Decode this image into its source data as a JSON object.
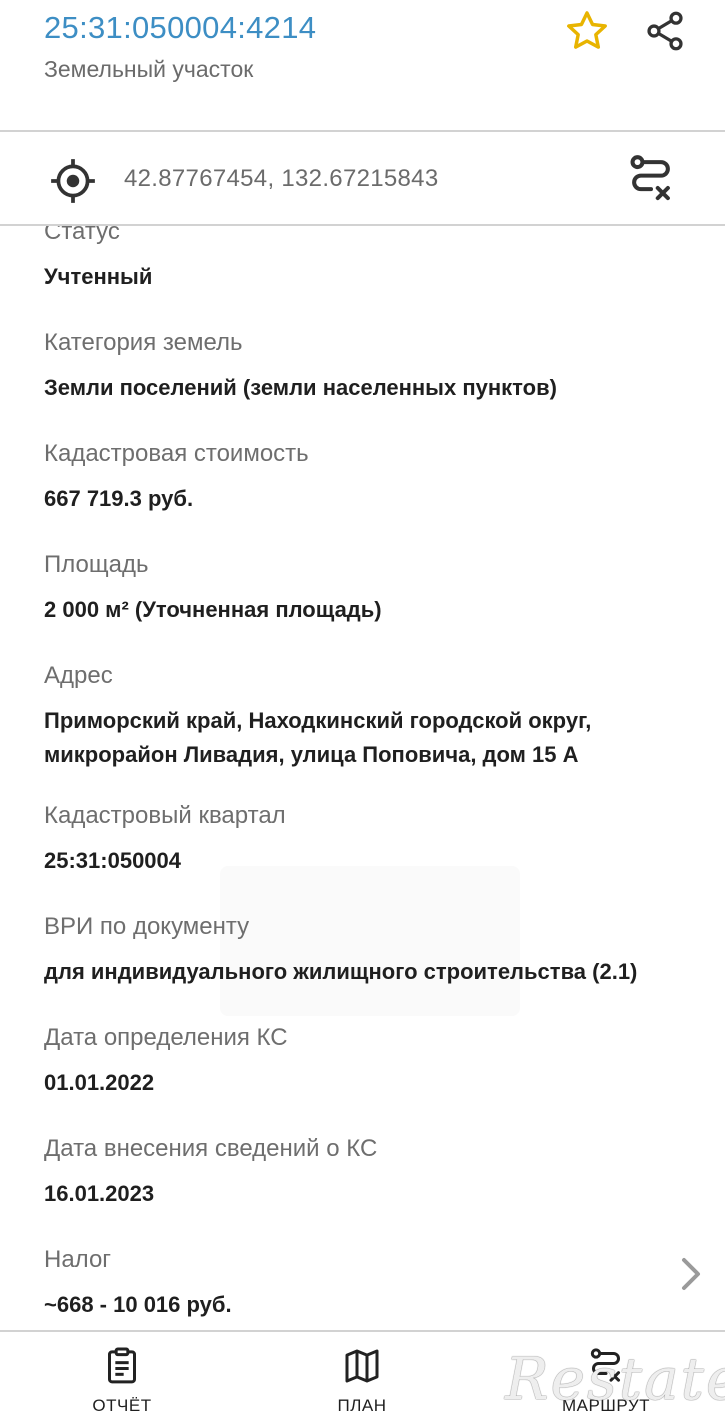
{
  "header": {
    "cadastral_number": "25:31:050004:4214",
    "object_type": "Земельный участок"
  },
  "location": {
    "coordinates": "42.87767454, 132.67215843"
  },
  "fields": [
    {
      "label": "Статус",
      "value": "Учтенный"
    },
    {
      "label": "Категория земель",
      "value": "Земли поселений (земли населенных пунктов)"
    },
    {
      "label": "Кадастровая стоимость",
      "value": "667 719.3 руб."
    },
    {
      "label": "Площадь",
      "value": "2 000 м² (Уточненная площадь)"
    },
    {
      "label": "Адрес",
      "value_line1": "Приморский край, Находкинский городской округ,",
      "value_line2": "микрорайон Ливадия, улица Поповича, дом 15 А"
    },
    {
      "label": "Кадастровый квартал",
      "value": "25:31:050004"
    },
    {
      "label": "ВРИ по документу",
      "value": "для индивидуального жилищного строительства (2.1)"
    },
    {
      "label": "Дата определения КС",
      "value": "01.01.2022"
    },
    {
      "label": "Дата внесения сведений о КС",
      "value": "16.01.2023"
    },
    {
      "label": "Налог",
      "value": "~668 - 10 016 руб."
    }
  ],
  "bottom_nav": {
    "report": "ОТЧЁТ",
    "plan": "ПЛАН",
    "route": "МАРШРУТ"
  },
  "watermark": "Restate",
  "colors": {
    "accent": "#3d8ec4",
    "star": "#e8b400",
    "label": "#6e6e6e",
    "divider": "#d2d2d2"
  },
  "icons": [
    "star-icon",
    "share-icon",
    "location-target-icon",
    "route-clear-icon",
    "chevron-right-icon",
    "clipboard-icon",
    "map-icon"
  ]
}
